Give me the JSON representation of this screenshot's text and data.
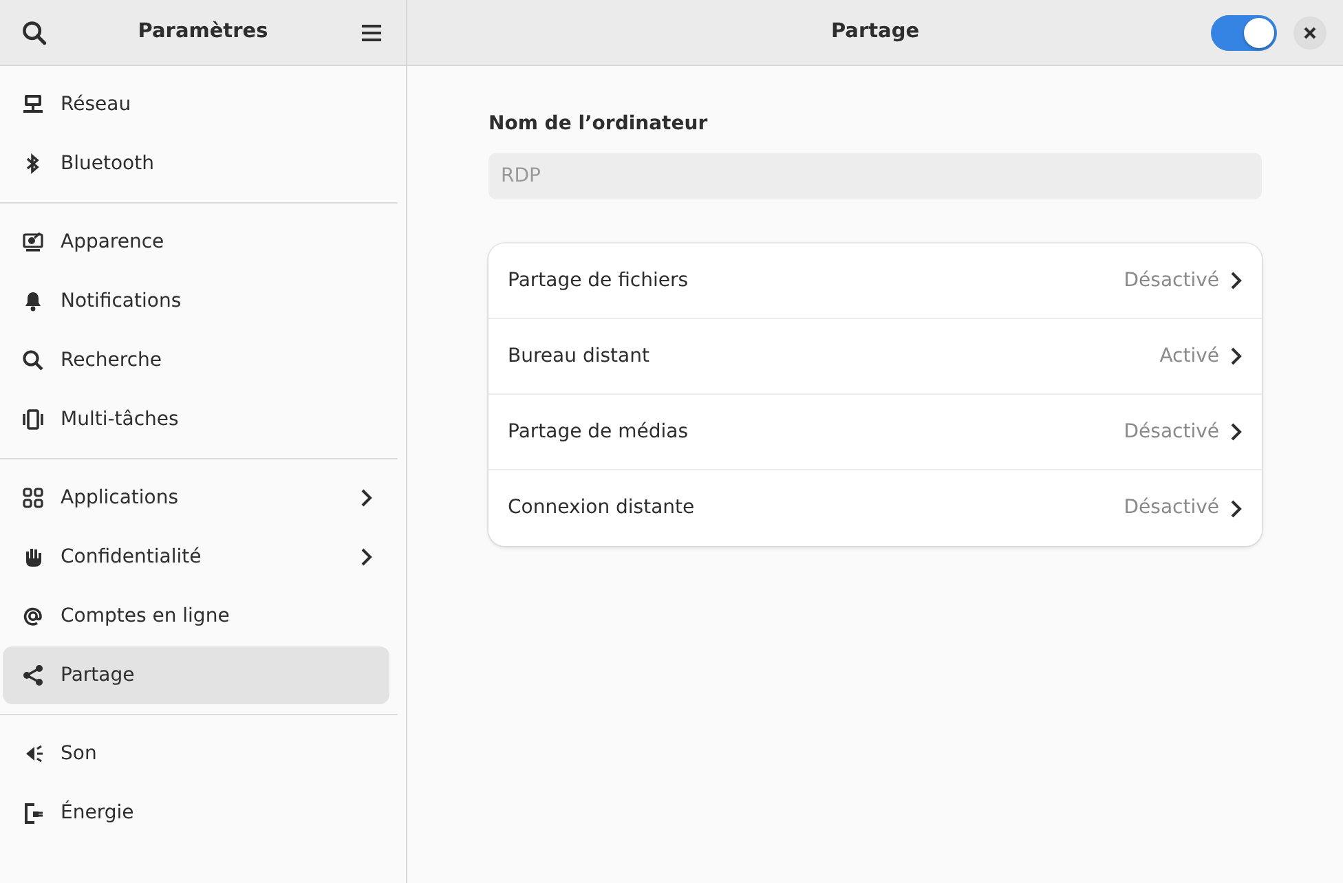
{
  "sidebar": {
    "title": "Paramètres",
    "groups": [
      [
        {
          "label": "Réseau",
          "selected": false,
          "submenu": false
        },
        {
          "label": "Bluetooth",
          "selected": false,
          "submenu": false
        }
      ],
      [
        {
          "label": "Apparence",
          "selected": false,
          "submenu": false
        },
        {
          "label": "Notifications",
          "selected": false,
          "submenu": false
        },
        {
          "label": "Recherche",
          "selected": false,
          "submenu": false
        },
        {
          "label": "Multi-tâches",
          "selected": false,
          "submenu": false
        }
      ],
      [
        {
          "label": "Applications",
          "selected": false,
          "submenu": true
        },
        {
          "label": "Confidentialité",
          "selected": false,
          "submenu": true
        },
        {
          "label": "Comptes en ligne",
          "selected": false,
          "submenu": false
        },
        {
          "label": "Partage",
          "selected": true,
          "submenu": false
        }
      ],
      [
        {
          "label": "Son",
          "selected": false,
          "submenu": false
        },
        {
          "label": "Énergie",
          "selected": false,
          "submenu": false
        }
      ]
    ]
  },
  "page": {
    "title": "Partage",
    "sharing_on": true,
    "computer_name": {
      "label": "Nom de l’ordinateur",
      "value": "RDP",
      "disabled": true
    },
    "rows": [
      {
        "label": "Partage de fichiers",
        "status": "Désactivé"
      },
      {
        "label": "Bureau distant",
        "status": "Activé"
      },
      {
        "label": "Partage de médias",
        "status": "Désactivé"
      },
      {
        "label": "Connexion distante",
        "status": "Désactivé"
      }
    ]
  }
}
